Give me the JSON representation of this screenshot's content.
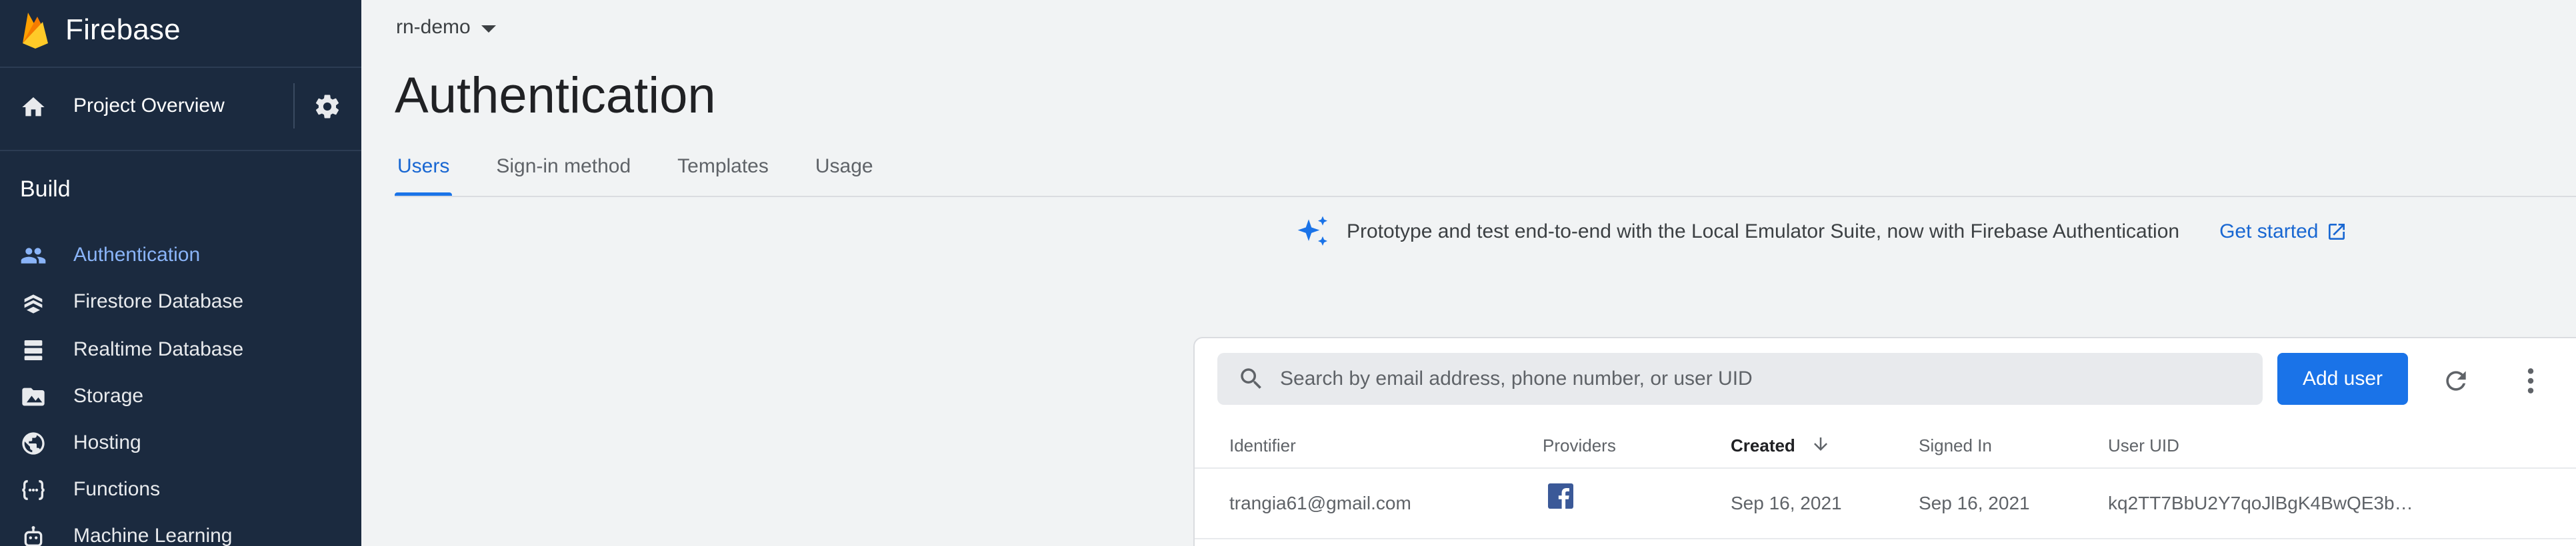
{
  "brand": {
    "name": "Firebase"
  },
  "sidebar": {
    "overview_label": "Project Overview",
    "section_title": "Build",
    "items": [
      {
        "label": "Authentication",
        "icon": "users-icon",
        "active": true
      },
      {
        "label": "Firestore Database",
        "icon": "firestore-icon",
        "active": false
      },
      {
        "label": "Realtime Database",
        "icon": "database-icon",
        "active": false
      },
      {
        "label": "Storage",
        "icon": "image-icon",
        "active": false
      },
      {
        "label": "Hosting",
        "icon": "globe-icon",
        "active": false
      },
      {
        "label": "Functions",
        "icon": "functions-icon",
        "active": false
      },
      {
        "label": "Machine Learning",
        "icon": "robot-icon",
        "active": false
      }
    ]
  },
  "header": {
    "project": "rn-demo",
    "title": "Authentication"
  },
  "tabs": [
    {
      "label": "Users",
      "active": true
    },
    {
      "label": "Sign-in method",
      "active": false
    },
    {
      "label": "Templates",
      "active": false
    },
    {
      "label": "Usage",
      "active": false
    }
  ],
  "promo": {
    "message": "Prototype and test end-to-end with the Local Emulator Suite, now with Firebase Authentication",
    "link_label": "Get started"
  },
  "users": {
    "search_placeholder": "Search by email address, phone number, or user UID",
    "add_user_label": "Add user",
    "columns": {
      "identifier": "Identifier",
      "providers": "Providers",
      "created": "Created",
      "signed_in": "Signed In",
      "user_uid": "User UID"
    },
    "rows": [
      {
        "identifier": "trangia61@gmail.com",
        "provider_icon": "facebook-icon",
        "created": "Sep 16, 2021",
        "signed_in": "Sep 16, 2021",
        "user_uid": "kq2TT7BbU2Y7qoJlBgK4BwQE3b…"
      }
    ]
  },
  "colors": {
    "sidebar_bg": "#1b2a3f",
    "accent": "#1a73e8",
    "active_nav": "#8ab4f8",
    "page_bg": "#f1f3f4"
  }
}
